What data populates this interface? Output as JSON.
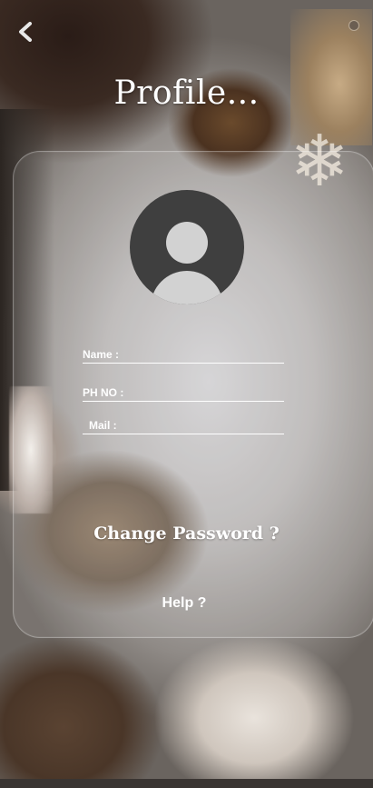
{
  "header": {
    "title": "Profile...",
    "back_icon": "chevron-left-icon"
  },
  "avatar": {
    "icon": "user-avatar-icon",
    "bg_color": "#3f3f3f",
    "fg_color": "#d2d2d2"
  },
  "form": {
    "name_label": "Name :",
    "name_value": "",
    "phone_label": "PH NO :",
    "phone_value": "",
    "mail_label": "Mail :",
    "mail_value": ""
  },
  "actions": {
    "change_password_label": "Change Password ?",
    "help_label": "Help ?"
  },
  "colors": {
    "text": "#ffffff",
    "card_border": "rgba(255,255,255,0.30)"
  }
}
